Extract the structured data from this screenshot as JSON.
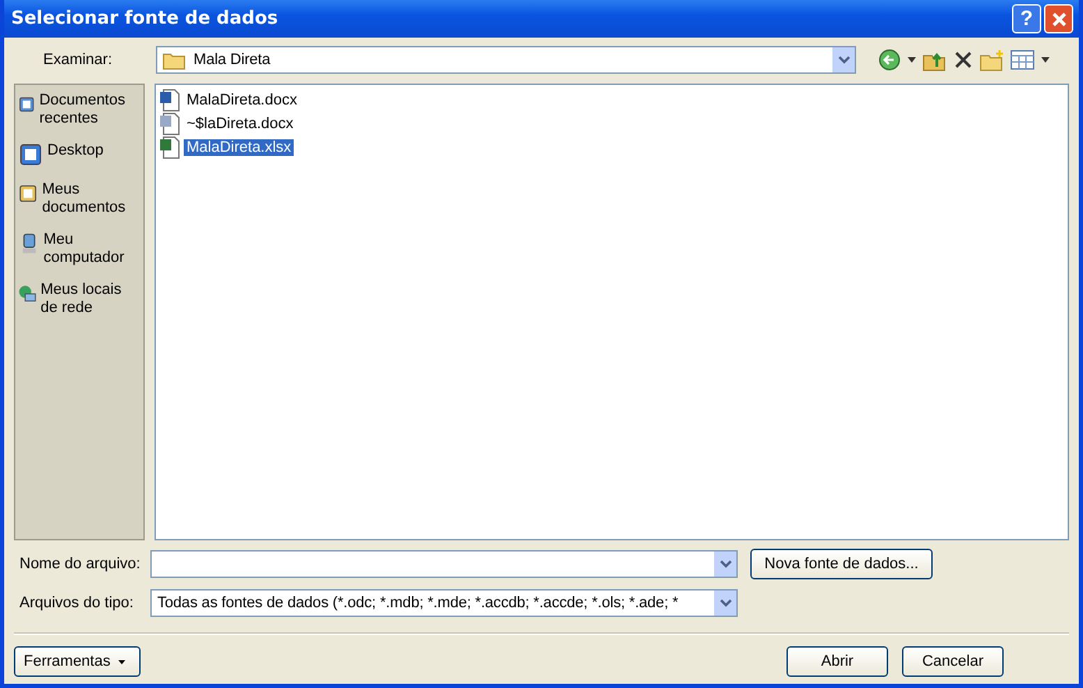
{
  "window": {
    "title": "Selecionar fonte de dados",
    "help": "?"
  },
  "look_in": {
    "label": "Examinar:",
    "value": "Mala Direta"
  },
  "sidebar": {
    "items": [
      {
        "label": "Documentos recentes",
        "kind": "recent"
      },
      {
        "label": "Desktop",
        "kind": "desktop"
      },
      {
        "label": "Meus documentos",
        "kind": "documents"
      },
      {
        "label": "Meu computador",
        "kind": "computer"
      },
      {
        "label": "Meus locais de rede",
        "kind": "network"
      }
    ]
  },
  "files": [
    {
      "name": "MalaDireta.docx",
      "kind": "word",
      "selected": false
    },
    {
      "name": "~$laDireta.docx",
      "kind": "word-temp",
      "selected": false
    },
    {
      "name": "MalaDireta.xlsx",
      "kind": "excel",
      "selected": true
    }
  ],
  "file_name": {
    "label": "Nome do arquivo:"
  },
  "file_type": {
    "label": "Arquivos do tipo:",
    "value": "Todas as fontes de dados (*.odc; *.mdb; *.mde; *.accdb; *.accde; *.ols; *.ade; *"
  },
  "buttons": {
    "new_source": "Nova fonte de dados...",
    "tools": "Ferramentas",
    "open": "Abrir",
    "cancel": "Cancelar"
  }
}
